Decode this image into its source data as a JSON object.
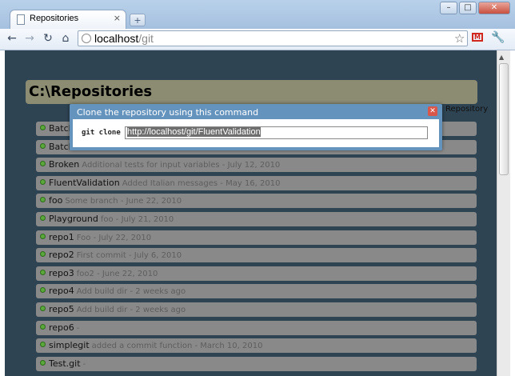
{
  "browser": {
    "tab_title": "Repositories",
    "tab_close": "×",
    "new_tab": "+",
    "window_buttons": {
      "minimize": "–",
      "maximize": "□",
      "close": "✕"
    },
    "nav": {
      "back": "←",
      "forward": "→",
      "reload": "↻",
      "home": "⌂"
    },
    "url_host": "localhost",
    "url_path": "/git",
    "icons": [
      "page-icon",
      "globe-icon",
      "star-icon",
      "gmail-icon",
      "wrench-icon"
    ]
  },
  "page": {
    "title": "C:\\Repositories",
    "header_link": "Repository",
    "repositories": [
      {
        "name": "Batch",
        "description": ""
      },
      {
        "name": "Batch",
        "description": ""
      },
      {
        "name": "Broken",
        "description": "Additional tests for input variables - July 12, 2010"
      },
      {
        "name": "FluentValidation",
        "description": "Added Italian messages - May 16, 2010"
      },
      {
        "name": "foo",
        "description": "Some branch - June 22, 2010"
      },
      {
        "name": "Playground",
        "description": "foo - July 21, 2010"
      },
      {
        "name": "repo1",
        "description": "Foo - July 22, 2010"
      },
      {
        "name": "repo2",
        "description": "First commit - July 6, 2010"
      },
      {
        "name": "repo3",
        "description": "foo2 - June 22, 2010"
      },
      {
        "name": "repo4",
        "description": "Add build dir - 2 weeks ago"
      },
      {
        "name": "repo5",
        "description": "Add build dir - 2 weeks ago"
      },
      {
        "name": "repo6",
        "description": "-"
      },
      {
        "name": "simplegit",
        "description": "added a commit function - March 10, 2010"
      },
      {
        "name": "Test.git",
        "description": "-"
      }
    ]
  },
  "dialog": {
    "title": "Clone the repository using this command",
    "label": "git clone",
    "value": "http://localhost/git/FluentValidation",
    "close": "✕"
  },
  "colors": {
    "page_background": "#2e4453",
    "row_background": "#898989",
    "header_background": "#8c8c73",
    "dialog_background": "#6493be",
    "bullet": "#5aa83a"
  }
}
